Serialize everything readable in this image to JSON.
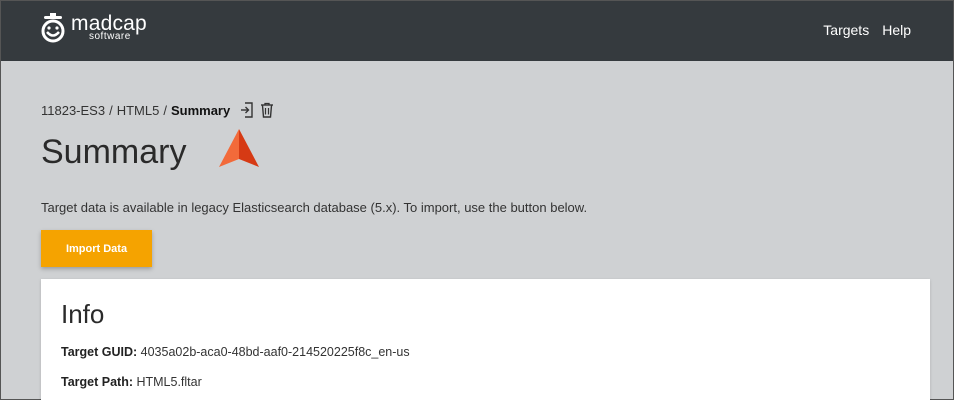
{
  "header": {
    "brand": "madcap",
    "brand_sub": "software",
    "nav": [
      {
        "label": "Targets"
      },
      {
        "label": "Help"
      }
    ]
  },
  "breadcrumb": {
    "items": [
      "11823-ES3",
      "HTML5"
    ],
    "separator": "/",
    "current": "Summary",
    "icons": [
      "import-icon",
      "trash-icon"
    ]
  },
  "page": {
    "title": "Summary",
    "notice": "Target data is available in legacy Elasticsearch database (5.x). To import, use the button below.",
    "import_button": "Import Data"
  },
  "info": {
    "title": "Info",
    "rows": [
      {
        "key": "Target GUID:",
        "value": "4035a02b-aca0-48bd-aaf0-214520225f8c_en-us"
      },
      {
        "key": "Target Path:",
        "value": "HTML5.fltar"
      }
    ]
  },
  "colors": {
    "header_bg": "#353a3e",
    "page_bg": "#cfd1d3",
    "accent_button": "#f5a300",
    "cursor": "#f04e23"
  }
}
